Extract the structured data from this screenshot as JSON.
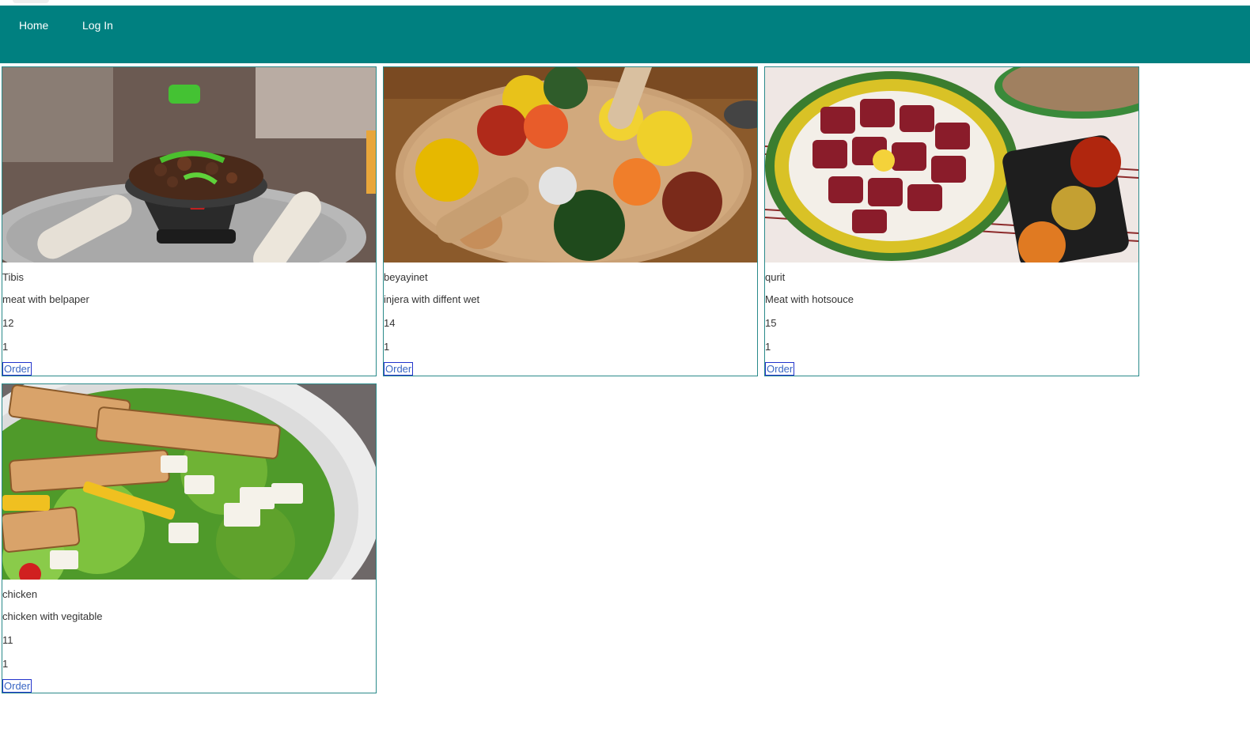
{
  "nav": {
    "home_label": "Home",
    "login_label": "Log In"
  },
  "colors": {
    "navbar": "#008080",
    "card_border": "#2a8a8a",
    "order_border": "#2233cc",
    "order_text": "#3a66c4"
  },
  "products": [
    {
      "name": "Tibis",
      "description": "meat with belpaper",
      "price": "12",
      "quantity": "1",
      "order_label": "Order",
      "image_icon": "tibs-dish-photo"
    },
    {
      "name": "beyayinet",
      "description": "injera with diffent wet",
      "price": "14",
      "quantity": "1",
      "order_label": "Order",
      "image_icon": "beyaynetu-platter-photo"
    },
    {
      "name": "qurit",
      "description": "Meat with hotsouce",
      "price": "15",
      "quantity": "1",
      "order_label": "Order",
      "image_icon": "raw-meat-platter-photo"
    },
    {
      "name": "chicken",
      "description": "chicken with vegitable",
      "price": "11",
      "quantity": "1",
      "order_label": "Order",
      "image_icon": "chicken-salad-photo"
    }
  ]
}
